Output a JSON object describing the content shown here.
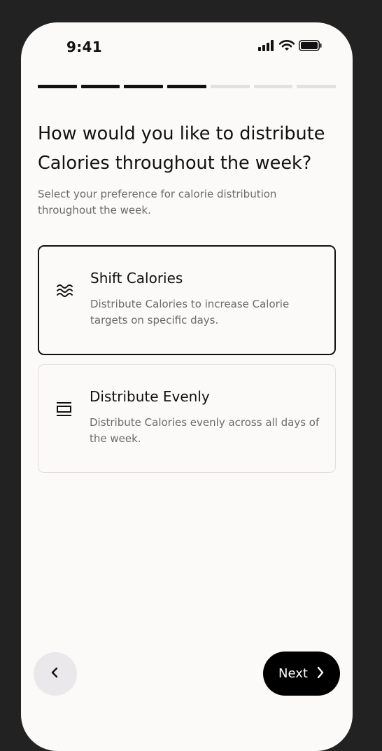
{
  "status_bar": {
    "time": "9:41"
  },
  "progress": {
    "total_steps": 7,
    "completed_steps": 4
  },
  "colors": {
    "progress_active": "#111111",
    "progress_inactive": "#e3e0e0",
    "accent": "#000000"
  },
  "header": {
    "title": "How would you like to distribute Calories throughout the week?",
    "subtitle": "Select your preference for calorie distribution throughout the week."
  },
  "options": [
    {
      "icon": "waves-icon",
      "title": "Shift Calories",
      "description": "Distribute Calories to increase Calorie targets on specific days.",
      "selected": true
    },
    {
      "icon": "stacked-bars-icon",
      "title": "Distribute Evenly",
      "description": "Distribute Calories evenly across all days of the week.",
      "selected": false
    }
  ],
  "footer": {
    "back_icon": "chevron-left-icon",
    "next_label": "Next",
    "next_icon": "chevron-right-icon"
  }
}
